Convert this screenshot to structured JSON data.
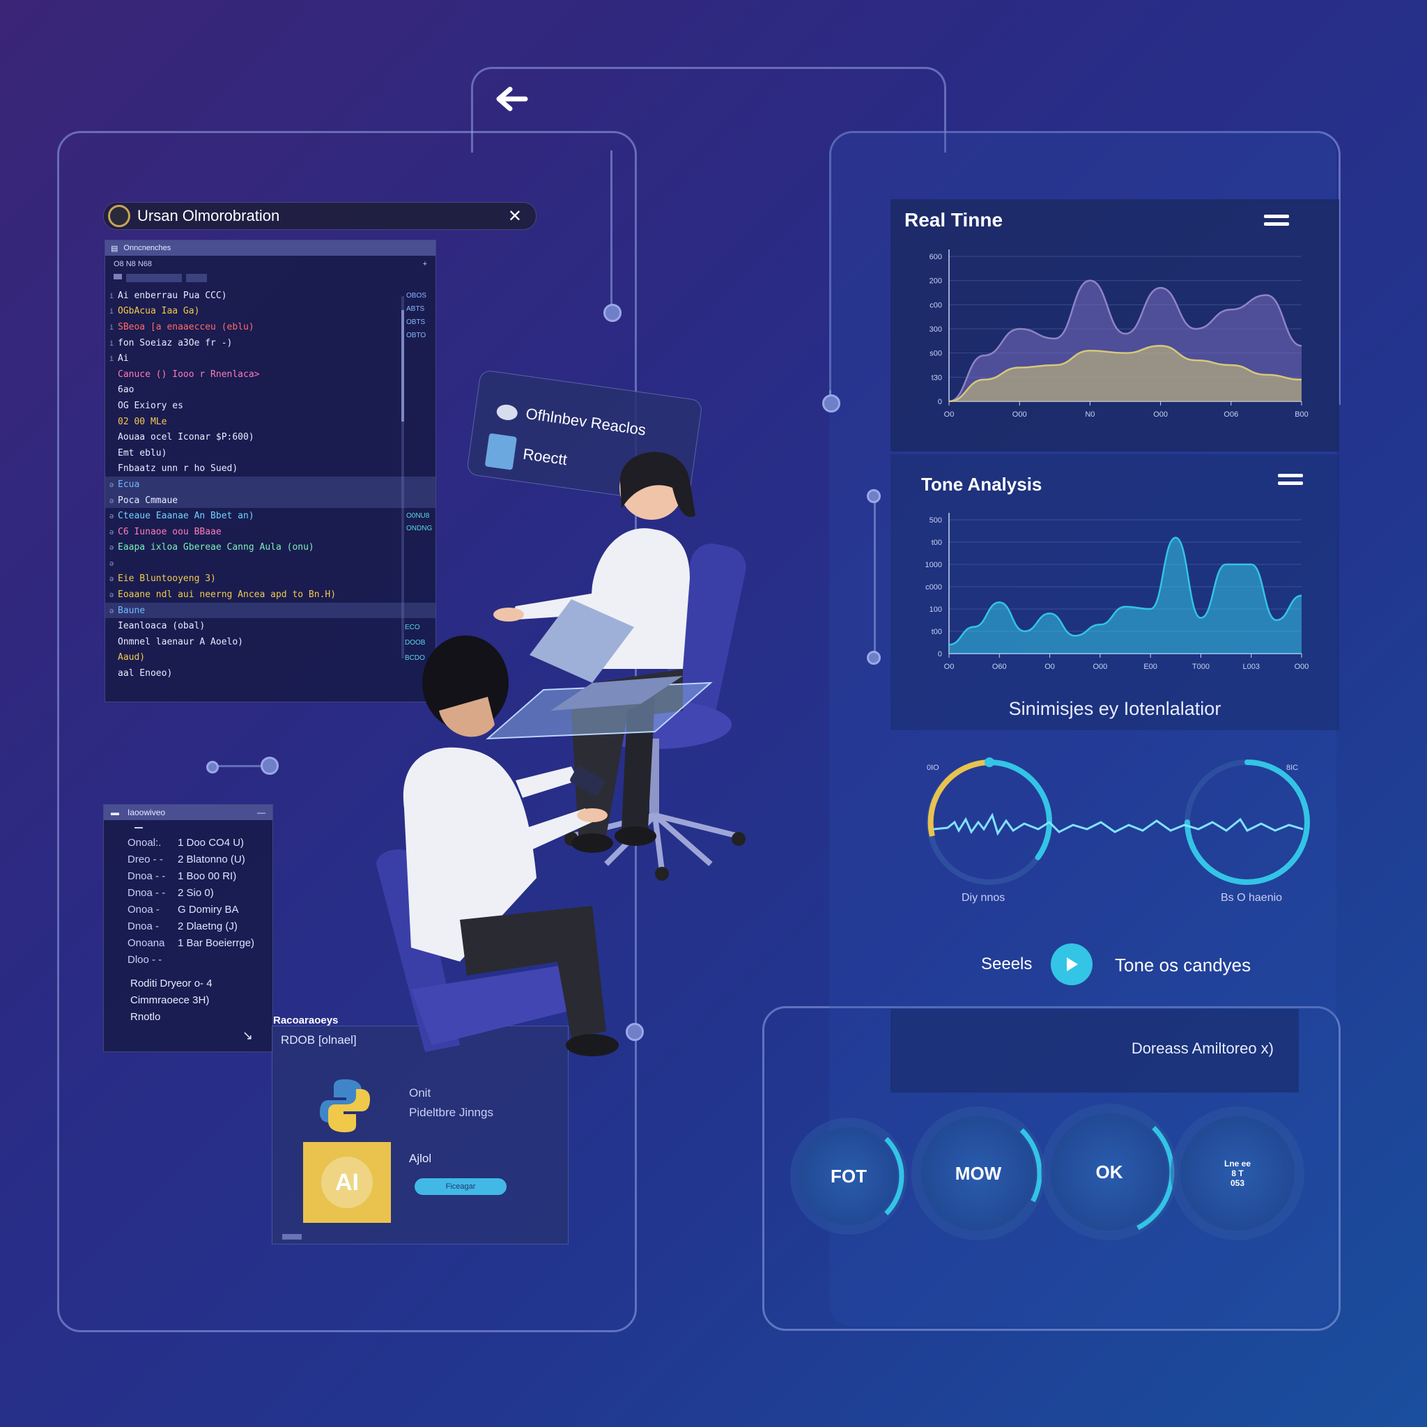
{
  "nav": {
    "back_icon": "arrow-left-icon"
  },
  "code_window": {
    "title": "Ursan Olmorobration",
    "tab": "Onncnenches",
    "toolbar": "O8  N8  N68",
    "lines": [
      {
        "text": "Ai enberrau Pua CCC)",
        "color": "#e8ecff",
        "hl": false
      },
      {
        "text": "  OGbAcua Iaa Ga)",
        "color": "#f2c94c",
        "hl": false
      },
      {
        "text": "SBeoa [a enaaecceu (eblu)",
        "color": "#ff6b6b",
        "hl": false
      },
      {
        "text": "  fon Soeiaz a3Oe fr -)",
        "color": "#e8ecff",
        "hl": false
      },
      {
        "text": "  Ai",
        "color": "#e8ecff",
        "hl": false
      },
      {
        "text": "  Canuce () Iooo r Rnenlaca>",
        "color": "#ff7ab8",
        "hl": false
      },
      {
        "text": "  6ao",
        "color": "#e8ecff",
        "hl": false
      },
      {
        "text": "  OG Exiory es",
        "color": "#e8ecff",
        "hl": false
      },
      {
        "text": "    02 00 MLe",
        "color": "#f2c94c",
        "hl": false
      },
      {
        "text": "    Aouaa ocel Iconar $P:600)",
        "color": "#e8ecff",
        "hl": false
      },
      {
        "text": "    Emt eblu)",
        "color": "#e8ecff",
        "hl": false
      },
      {
        "text": "  Fnbaatz unn r ho Sued)",
        "color": "#e8ecff",
        "hl": false
      },
      {
        "text": "Ecua",
        "color": "#6fb8ff",
        "hl": true
      },
      {
        "text": "Poca Cmmaue",
        "color": "#e8ecff",
        "hl": true
      },
      {
        "text": "Cteaue Eaanae An Bbet an)",
        "color": "#6fd3ff",
        "hl": false
      },
      {
        "text": "C6 Iunaoe oou BBaae",
        "color": "#ff7ab8",
        "hl": false
      },
      {
        "text": "Eaapa ixloa Gbereae Canng Aula (onu)",
        "color": "#7bf0b5",
        "hl": false
      },
      {
        "text": "",
        "color": "#e8ecff",
        "hl": false
      },
      {
        "text": "Eie Bluntooyeng 3)",
        "color": "#f2c94c",
        "hl": false
      },
      {
        "text": "Eoaane ndl aui neerng Ancea apd to Bn.H)",
        "color": "#f2c94c",
        "hl": false
      },
      {
        "text": "Baune",
        "color": "#6fb8ff",
        "hl": true
      },
      {
        "text": "  Ieanloaca (obal)",
        "color": "#e8ecff",
        "hl": false
      },
      {
        "text": "  Onmnel laenaur A Aoelo)",
        "color": "#e8ecff",
        "hl": false
      },
      {
        "text": "  Aaud)",
        "color": "#f2c94c",
        "hl": false
      },
      {
        "text": "  aal Enoeo)",
        "color": "#e8ecff",
        "hl": false
      }
    ],
    "side_tags": [
      "OBOS",
      "ABTS",
      "OBTS",
      "OBTO"
    ],
    "side_tags_lower": [
      "O0NU8",
      "ONDNG"
    ],
    "side_tags_bottom": [
      "ECO",
      "DOOB",
      "BCDO"
    ]
  },
  "timeline": {
    "title": "Iaoowiveo",
    "rows": [
      [
        "Onoal:.",
        "1 Doo  CO4 U)"
      ],
      [
        "Dreo - -",
        "2 Blatonno (U)"
      ],
      [
        "Dnoa - -",
        "1 Boo  00  RI)"
      ],
      [
        "Dnoa - -",
        "2 Sio  0)"
      ],
      [
        "Onoa -",
        "G Domiry BA"
      ],
      [
        "Dnoa -",
        "2 Dlaetng (J)"
      ],
      [
        "Onoana",
        "1 Bar Boeierrge)"
      ],
      [
        "Dloo  - -",
        ""
      ]
    ],
    "footer": [
      "Roditi Dryeor o- 4",
      "Cimmraoece   3H)",
      "Rnotlo"
    ]
  },
  "resources": {
    "title": "Racoaraoeys",
    "subtitle": "RDOB [olnael]",
    "item1_name": "Onit",
    "item1_desc": "Pideltbre Jinngs",
    "item2_name": "Ajlol",
    "item2_badge": "AI",
    "item2_button": "Ficeagar"
  },
  "bubble": {
    "line1": "Ofhlnbev Reaclos",
    "line2": "Roectt"
  },
  "realtime": {
    "title": "Real Tinne",
    "menu_icon": "menu-icon"
  },
  "tone": {
    "title": "Tone Analysis",
    "menu_icon": "menu-icon",
    "subtitle": "Sinimisjes ey Iotenlalatior"
  },
  "chart_data": [
    {
      "type": "area",
      "title": "Real Tinne",
      "ytick_labels": [
        "0",
        "t30",
        "s00",
        "300",
        "c00",
        "200",
        "600"
      ],
      "xtick_labels": [
        "O0",
        "O00",
        "N0",
        "O00",
        "O06",
        "B00"
      ],
      "x": [
        0,
        1,
        2,
        3,
        4,
        5,
        6,
        7,
        8,
        9,
        10
      ],
      "series": [
        {
          "values": [
            0,
            190,
            300,
            260,
            500,
            280,
            470,
            300,
            380,
            440,
            230
          ]
        },
        {
          "values": [
            0,
            90,
            140,
            150,
            210,
            200,
            230,
            170,
            150,
            110,
            90
          ]
        }
      ],
      "colors": [
        "#8f83c6",
        "#d6c979"
      ],
      "ylim": [
        0,
        600
      ]
    },
    {
      "type": "area",
      "title": "Tone Analysis",
      "ytick_labels": [
        "0",
        "t00",
        "100",
        "c000",
        "1000",
        "t00",
        "500"
      ],
      "xtick_labels": [
        "O0",
        "O60",
        "O0",
        "O00",
        "E00",
        "T000",
        "L003",
        "O00"
      ],
      "x": [
        0,
        1,
        2,
        3,
        4,
        5,
        6,
        7,
        8,
        9,
        10,
        11,
        12,
        13,
        14
      ],
      "series": [
        {
          "values": [
            40,
            120,
            230,
            100,
            180,
            80,
            130,
            210,
            200,
            520,
            160,
            400,
            400,
            150,
            260
          ]
        }
      ],
      "colors": [
        "#33c4e6"
      ],
      "ylim": [
        0,
        600
      ]
    }
  ],
  "gauges": {
    "left_tick": "0IO",
    "right_tick": "8IC",
    "left_label": "Diy nnos",
    "right_label": "Bs O haenio",
    "left_fraction": 0.35,
    "right_fraction": 0.75
  },
  "controls": {
    "left_label": "Seeels",
    "right_label": "Tone os candyes",
    "play_icon": "play-icon"
  },
  "summary": {
    "text": "Doreass Amiltoreo x)"
  },
  "round_buttons": [
    {
      "label": "FOT",
      "progress": 0.25
    },
    {
      "label": "MOW",
      "progress": 0.2
    },
    {
      "label": "OK",
      "progress": 0.3
    },
    {
      "label": "Lne ee\n8 T\n053",
      "progress": 0
    }
  ],
  "colors": {
    "accent": "#33c4e6",
    "gold": "#e9c34e",
    "frame": "#96a5e6"
  }
}
